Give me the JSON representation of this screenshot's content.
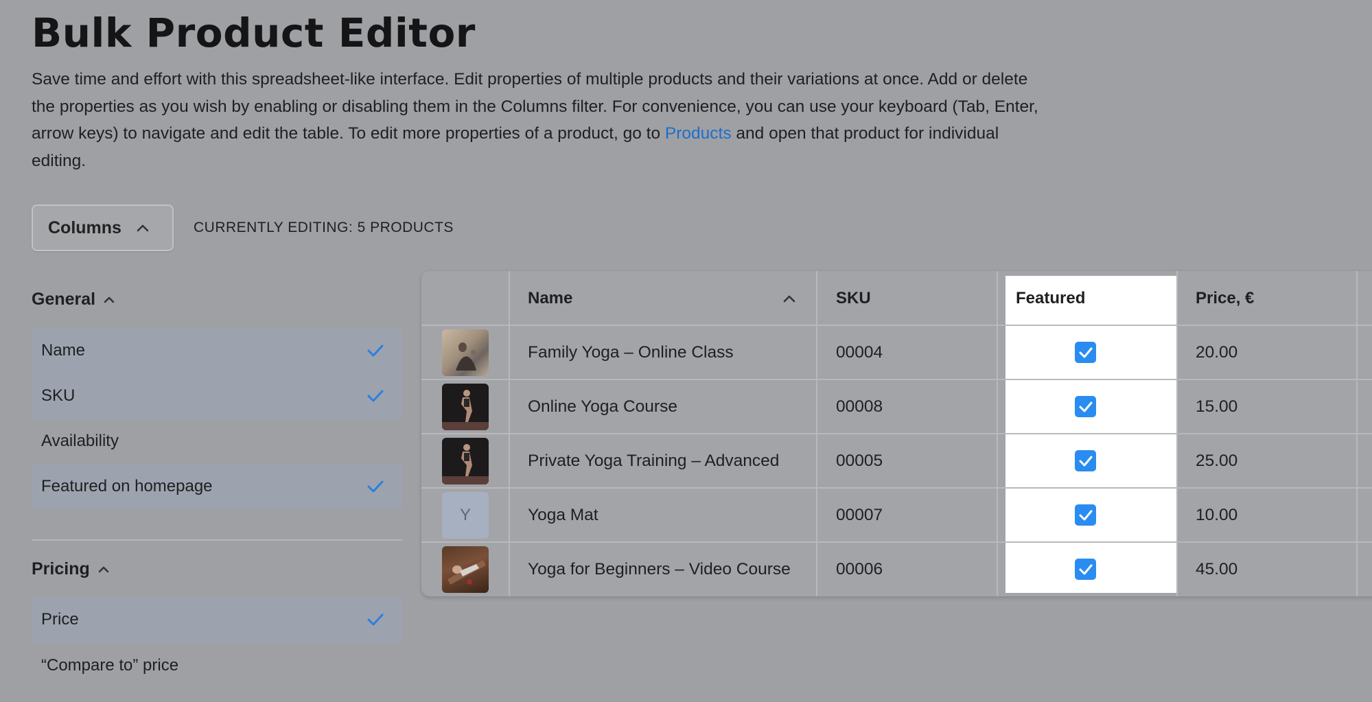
{
  "header": {
    "title": "Bulk Product Editor",
    "intro_text": "Save time and effort with this spreadsheet-like interface. Edit properties of multiple products and their variations at once. Add or delete the properties as you wish by enabling or disabling them in the Columns filter. For convenience, you can use your keyboard (Tab, Enter, arrow keys) to navigate and edit the table. To edit more properties of a product, go to ",
    "intro_link": "Products",
    "intro_suffix": " and open that product for individual editing."
  },
  "toolbar": {
    "columns_label": "Columns",
    "editing_status": "CURRENTLY EDITING: 5 PRODUCTS"
  },
  "sidebar": {
    "general": {
      "title": "General",
      "items": [
        {
          "label": "Name",
          "checked": true
        },
        {
          "label": "SKU",
          "checked": true
        },
        {
          "label": "Availability",
          "checked": false
        },
        {
          "label": "Featured on homepage",
          "checked": true
        }
      ]
    },
    "pricing": {
      "title": "Pricing",
      "items": [
        {
          "label": "Price",
          "checked": true
        },
        {
          "label": "“Compare to” price",
          "checked": false
        }
      ]
    }
  },
  "table": {
    "headers": {
      "name": "Name",
      "sku": "SKU",
      "featured": "Featured",
      "price": "Price, €"
    },
    "rows": [
      {
        "thumb": "photo",
        "name": "Family Yoga – Online Class",
        "sku": "00004",
        "featured": true,
        "price": "20.00"
      },
      {
        "thumb": "photo",
        "name": "Online Yoga Course",
        "sku": "00008",
        "featured": true,
        "price": "15.00"
      },
      {
        "thumb": "photo",
        "name": "Private Yoga Training – Advanced",
        "sku": "00005",
        "featured": true,
        "price": "25.00"
      },
      {
        "thumb": "Y",
        "name": "Yoga Mat",
        "sku": "00007",
        "featured": true,
        "price": "10.00"
      },
      {
        "thumb": "photo",
        "name": "Yoga for Beginners – Video Course",
        "sku": "00006",
        "featured": true,
        "price": "45.00"
      }
    ]
  },
  "colors": {
    "accent": "#2a8cf0",
    "link": "#1a6fcf",
    "overlay_bg": "#9fa0a3"
  }
}
